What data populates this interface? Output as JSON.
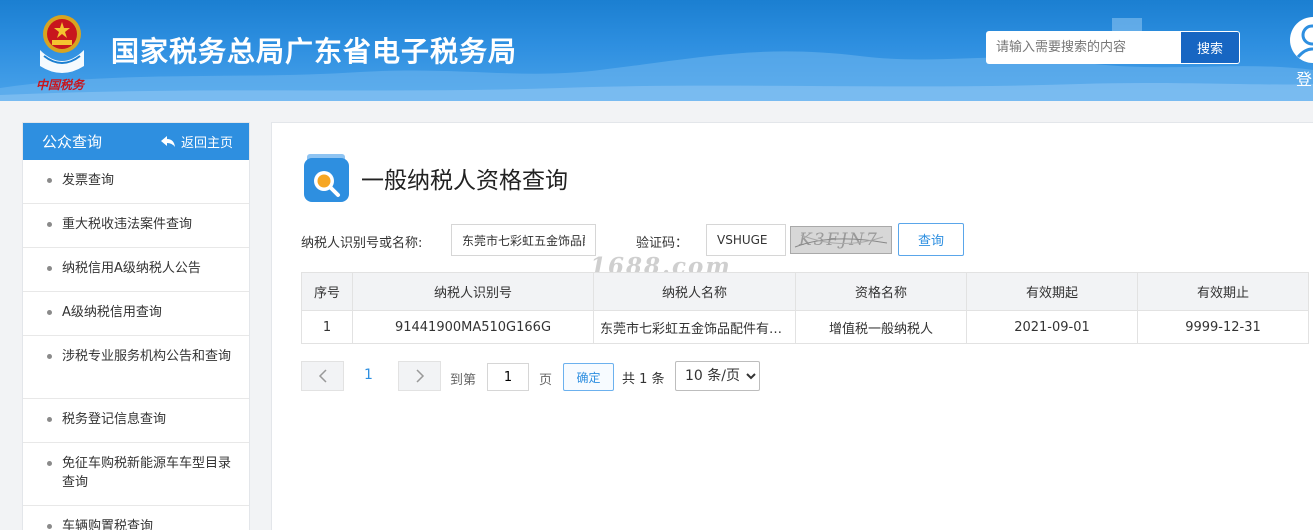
{
  "header": {
    "site_title": "国家税务总局广东省电子税务局",
    "emblem_caption": "中国税务",
    "search_placeholder": "请输入需要搜索的内容",
    "search_button": "搜索",
    "login_label": "登",
    "emblem_icon": "national-emblem-icon",
    "login_icon": "user-icon"
  },
  "sidebar": {
    "title": "公众查询",
    "back_label": "返回主页",
    "items": [
      "发票查询",
      "重大税收违法案件查询",
      "纳税信用A级纳税人公告",
      "A级纳税信用查询",
      "涉税专业服务机构公告和查询",
      "税务登记信息查询",
      "免征车购税新能源车车型目录查询",
      "车辆购置税查询"
    ]
  },
  "main": {
    "title": "一般纳税人资格查询",
    "form": {
      "taxpayer_label": "纳税人识别号或名称:",
      "taxpayer_value": "东莞市七彩虹五金饰品配件",
      "captcha_label": "验证码：",
      "captcha_value": "VSHUGE",
      "captcha_image_text": "K3FJN7",
      "query_button": "查询"
    },
    "watermark": "1688.com",
    "table": {
      "headers": [
        "序号",
        "纳税人识别号",
        "纳税人名称",
        "资格名称",
        "有效期起",
        "有效期止"
      ],
      "rows": [
        [
          "1",
          "91441900MA510G166G",
          "东莞市七彩虹五金饰品配件有限公司",
          "增值税一般纳税人",
          "2021-09-01",
          "9999-12-31"
        ]
      ]
    },
    "pagination": {
      "current_page": "1",
      "goto_label": "到第",
      "goto_value": "1",
      "page_unit": "页",
      "confirm": "确定",
      "total": "共 1 条",
      "page_size": "10 条/页"
    }
  },
  "colors": {
    "header_blue": "#2e8fe0",
    "accent_blue": "#1766c2",
    "link_blue": "#2e8fe0"
  }
}
